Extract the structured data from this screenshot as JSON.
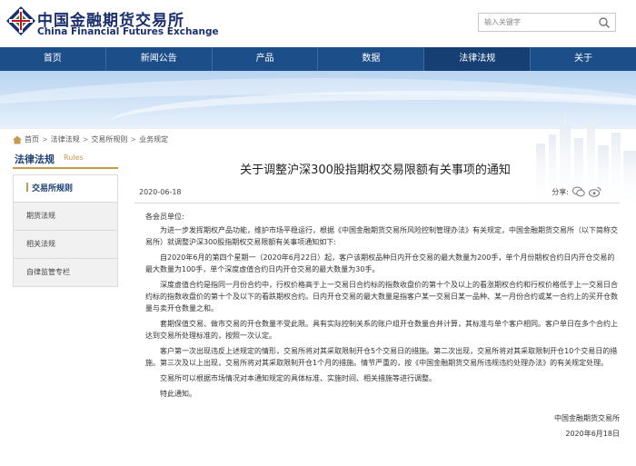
{
  "header": {
    "logo_cn": "中国金融期货交易所",
    "logo_en": "China Financial Futures Exchange",
    "search_placeholder": "输入关键字",
    "brand_color": "#1a2f6e"
  },
  "nav": {
    "items": [
      {
        "label": "首页"
      },
      {
        "label": "新闻公告"
      },
      {
        "label": "产品"
      },
      {
        "label": "数据"
      },
      {
        "label": "法律法规"
      },
      {
        "label": "关于"
      }
    ],
    "active_index": 4,
    "color": "#1c4e8a"
  },
  "breadcrumb": {
    "items": [
      "首页",
      "法律法规",
      "交易所规则",
      "业务规定"
    ],
    "separator": ">"
  },
  "sidebar": {
    "title_cn": "法律法规",
    "title_en": "Rules",
    "items": [
      {
        "label": "交易所规则",
        "active": true
      },
      {
        "label": "期货法规",
        "active": false
      },
      {
        "label": "相关法规",
        "active": false
      },
      {
        "label": "自律监管专栏",
        "active": false
      }
    ],
    "accent_color": "#c69a4c"
  },
  "article": {
    "title": "关于调整沪深300股指期权交易限额有关事项的通知",
    "date": "2020-06-18",
    "share_label": "分享:",
    "salutation": "各会员单位:",
    "paragraphs": [
      "为进一步发挥期权产品功能，维护市场平稳运行，根据《中国金融期货交易所风险控制管理办法》有关规定，中国金融期货交易所（以下简称交易所）就调整沪深300股指期权交易限额有关事项通知如下:",
      "自2020年6月的第四个星期一（2020年6月22日）起，客户该期权品种日内开仓交易的最大数量为200手，单个月份期权合约日内开仓交易的最大数量为100手，单个深度虚值合约日内开仓交易的最大数量为30手。",
      "深度虚值合约是指同一月份合约中，行权价格高于上一交易日合约标的指数收盘价的第十个及以上的看涨期权合约和行权价格低于上一交易日合约标的指数收盘价的第十个及以下的看跌期权合约。日内开仓交易的最大数量是指客户某一交易日某一品种、某一月份合约或某一合约上的买开仓数量与卖开仓数量之和。",
      "套期保值交易、做市交易的开仓数量不受此限。具有实际控制关系的账户组开仓数量合并计算，其标准与单个客户相同。客户单日在多个合约上达到交易所处理标准的，按照一次认定。",
      "客户第一次出现违反上述规定的情形，交易所将对其采取限制开仓5个交易日的措施。第二次出现，交易所将对其采取限制开仓10个交易日的措施。第三次及以上出现，交易所将对其采取限制开仓1个月的措施。情节严重的，按《中国金融期货交易所违规违约处理办法》的有关规定处理。",
      "交易所可以根据市场情况对本通知规定的具体标准、实施时间、相关措施等进行调整。",
      "特此通知。"
    ],
    "signature_org": "中国金融期货交易所",
    "signature_date": "2020年6月18日"
  }
}
